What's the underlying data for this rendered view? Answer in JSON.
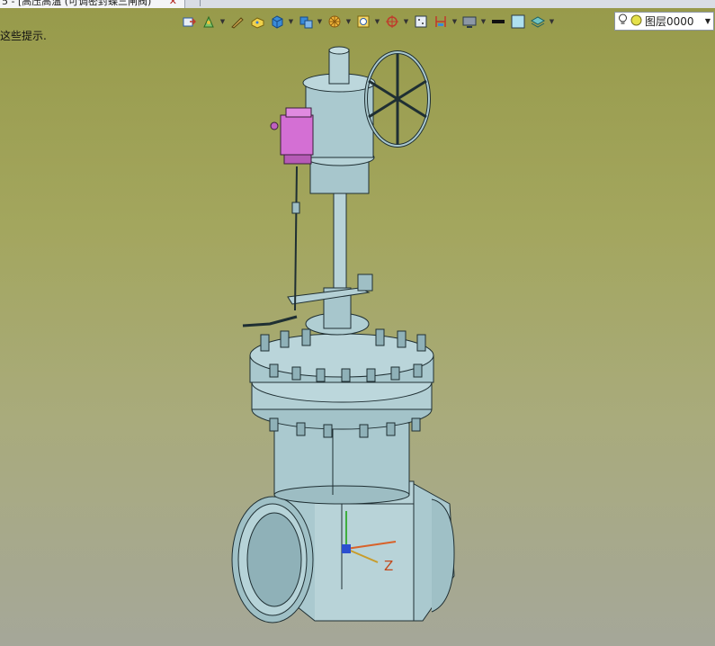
{
  "tab": {
    "title": "5 - [高压高温 (可调密封蝶三闸阀)",
    "close": "✕"
  },
  "hint_text": "这些提示.",
  "toolbar": {
    "items": [
      {
        "icon": "import-icon",
        "dropdown": false
      },
      {
        "icon": "drill-sketch-icon",
        "dropdown": true
      },
      {
        "icon": "pen-icon",
        "dropdown": false
      },
      {
        "icon": "cheese-block-icon",
        "dropdown": false
      },
      {
        "icon": "cube-icon",
        "dropdown": true
      },
      {
        "icon": "multi-part-icon",
        "dropdown": true
      },
      {
        "icon": "pattern-icon",
        "dropdown": true
      },
      {
        "icon": "measure-icon",
        "dropdown": true
      },
      {
        "icon": "coordinate-icon",
        "dropdown": true
      },
      {
        "icon": "grid-icon",
        "dropdown": false
      },
      {
        "icon": "section-icon",
        "dropdown": true
      },
      {
        "icon": "monitor-icon",
        "dropdown": true
      },
      {
        "icon": "line-style-icon",
        "dropdown": false
      },
      {
        "icon": "color-fill-icon",
        "dropdown": false
      },
      {
        "icon": "layer-stack-icon",
        "dropdown": true
      }
    ]
  },
  "layer": {
    "value": "图层0000",
    "icons": [
      "lightbulb-icon",
      "sun-icon"
    ]
  },
  "axis": {
    "label": "Z"
  },
  "colors": {
    "model": "#aac9cf",
    "model_dark": "#7fa4ab",
    "outline": "#1f2f33",
    "solenoid": "#d46fd4"
  }
}
